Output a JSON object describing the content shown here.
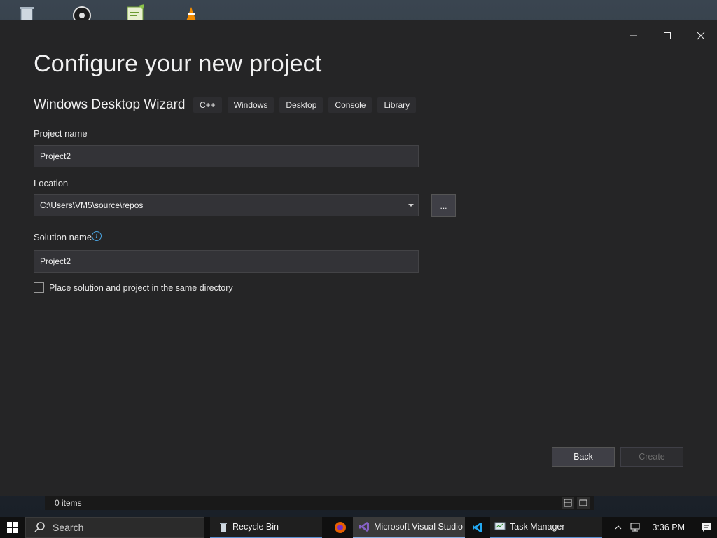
{
  "desktop": {
    "icons": [
      "recycle-bin",
      "obs-studio",
      "notepad-plus-plus",
      "vlc-cone"
    ]
  },
  "window": {
    "minimize_icon": "minimize-icon",
    "maximize_icon": "maximize-icon",
    "close_icon": "close-icon"
  },
  "page": {
    "title": "Configure your new project",
    "template_name": "Windows Desktop Wizard",
    "tags": [
      "C++",
      "Windows",
      "Desktop",
      "Console",
      "Library"
    ]
  },
  "form": {
    "project_name_label": "Project name",
    "project_name_value": "Project2",
    "location_label": "Location",
    "location_value": "C:\\Users\\VM5\\source\\repos",
    "browse_label": "...",
    "solution_name_label": "Solution name",
    "solution_name_value": "Project2",
    "same_dir_label": "Place solution and project in the same directory",
    "same_dir_checked": false
  },
  "buttons": {
    "back": "Back",
    "create": "Create"
  },
  "statusbar": {
    "items": "0 items"
  },
  "taskbar": {
    "search_placeholder": "Search",
    "tasks": [
      {
        "label": "Recycle Bin",
        "icon": "recycle-bin-icon"
      },
      {
        "label": "",
        "icon": "firefox-icon"
      },
      {
        "label": "Microsoft Visual Studio",
        "icon": "visual-studio-icon",
        "active": true
      },
      {
        "label": "",
        "icon": "vscode-icon"
      },
      {
        "label": "Task Manager",
        "icon": "task-manager-icon"
      }
    ],
    "time": "3:36 PM"
  },
  "colors": {
    "dialog_bg": "#252526",
    "field_bg": "#333337",
    "accent_blue": "#4aa3df",
    "vs_purple": "#8661c5"
  }
}
